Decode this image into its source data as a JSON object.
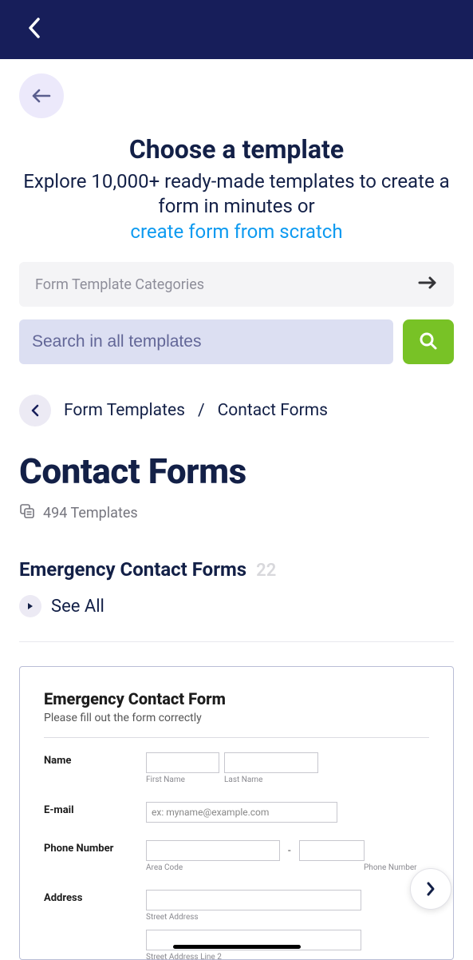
{
  "header": {
    "title": "Choose a template",
    "subtitle": "Explore 10,000+ ready-made templates to create a form in minutes or",
    "scratch_link": "create form from scratch"
  },
  "categories_btn": "Form Template Categories",
  "search": {
    "placeholder": "Search in all templates"
  },
  "breadcrumb": {
    "parent": "Form Templates",
    "sep": "/",
    "current": "Contact Forms"
  },
  "page": {
    "title": "Contact Forms",
    "template_count": "494 Templates"
  },
  "section": {
    "title": "Emergency Contact Forms",
    "count": "22",
    "see_all": "See All"
  },
  "preview": {
    "title": "Emergency Contact Form",
    "subtitle": "Please fill out the form correctly",
    "fields": {
      "name": {
        "label": "Name",
        "first_sub": "First Name",
        "last_sub": "Last Name"
      },
      "email": {
        "label": "E-mail",
        "placeholder": "ex: myname@example.com"
      },
      "phone": {
        "label": "Phone Number",
        "area_sub": "Area Code",
        "num_sub": "Phone Number",
        "dash": "-"
      },
      "address": {
        "label": "Address",
        "line1_sub": "Street Address",
        "line2_sub": "Street Address Line 2"
      }
    }
  }
}
